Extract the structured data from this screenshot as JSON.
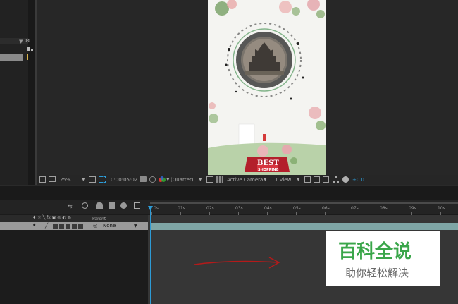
{
  "project_panel": {
    "rows": 2
  },
  "viewer": {
    "zoom": "25%",
    "timecode": "0:00:05:02",
    "resolution": "(Quarter)",
    "camera": "Active Camera",
    "views": "1 View",
    "exposure": "+0.0",
    "poster": {
      "badge_line1": "BEST",
      "badge_line2": "SHOPPING"
    }
  },
  "timeline": {
    "parent_header": "Parent",
    "parent_value": "None",
    "ruler_ticks": [
      "0s",
      "01s",
      "02s",
      "03s",
      "04s",
      "05s",
      "06s",
      "07s",
      "08s",
      "09s",
      "10s"
    ]
  },
  "watermark": {
    "title": "百科全说",
    "subtitle": "助你轻松解决"
  },
  "colors": {
    "accent": "#2d9bd6",
    "current_time": "#c0271e",
    "layer_bar": "#7fa6a6",
    "watermark_green": "#3aa64a"
  }
}
